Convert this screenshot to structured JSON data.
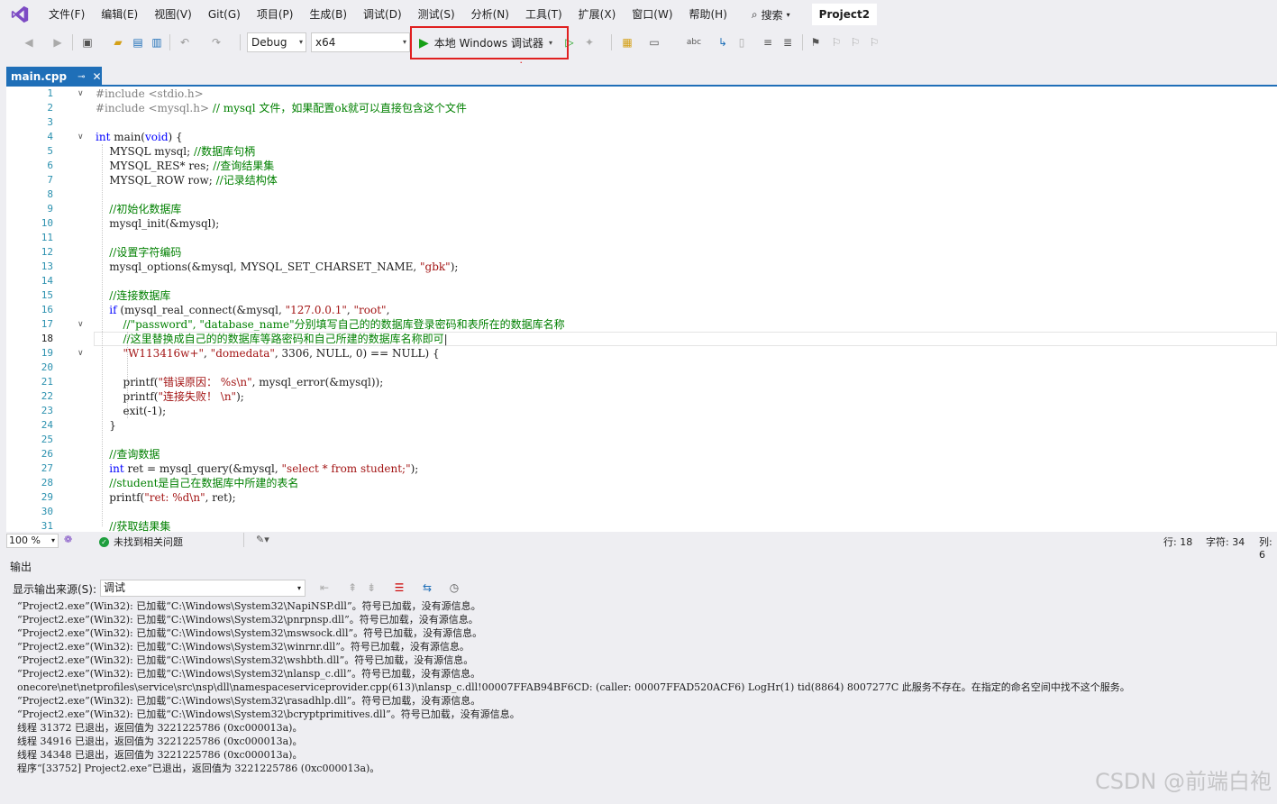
{
  "menubar": {
    "items": [
      "文件(F)",
      "编辑(E)",
      "视图(V)",
      "Git(G)",
      "项目(P)",
      "生成(B)",
      "调试(D)",
      "测试(S)",
      "分析(N)",
      "工具(T)",
      "扩展(X)",
      "窗口(W)",
      "帮助(H)"
    ],
    "search_label": "搜索",
    "project_name": "Project2"
  },
  "toolbar": {
    "config": "Debug",
    "platform": "x64",
    "run_label": "本地 Windows 调试器"
  },
  "tab": {
    "filename": "main.cpp"
  },
  "code_lines": [
    {
      "n": "1",
      "fold": "v",
      "html": "<span class=\"pp\">#include &lt;stdio.h&gt;</span>"
    },
    {
      "n": "2",
      "fold": "",
      "html": "<span class=\"pp\">#include &lt;mysql.h&gt;</span> <span class=\"cm\">// mysql 文件，如果配置ok就可以直接包含这个文件</span>"
    },
    {
      "n": "3",
      "fold": "",
      "html": ""
    },
    {
      "n": "4",
      "fold": "v",
      "html": "<span class=\"kw\">int</span> main(<span class=\"kw\">void</span>) {"
    },
    {
      "n": "5",
      "fold": "",
      "html": "    MYSQL mysql; <span class=\"cm\">//数据库句柄</span>"
    },
    {
      "n": "6",
      "fold": "",
      "html": "    MYSQL_RES* res; <span class=\"cm\">//查询结果集</span>"
    },
    {
      "n": "7",
      "fold": "",
      "html": "    MYSQL_ROW row; <span class=\"cm\">//记录结构体</span>"
    },
    {
      "n": "8",
      "fold": "",
      "html": ""
    },
    {
      "n": "9",
      "fold": "",
      "html": "    <span class=\"cm\">//初始化数据库</span>"
    },
    {
      "n": "10",
      "fold": "",
      "html": "    mysql_init(&amp;mysql);"
    },
    {
      "n": "11",
      "fold": "",
      "html": ""
    },
    {
      "n": "12",
      "fold": "",
      "html": "    <span class=\"cm\">//设置字符编码</span>"
    },
    {
      "n": "13",
      "fold": "",
      "html": "    mysql_options(&amp;mysql, MYSQL_SET_CHARSET_NAME, <span class=\"st\">\"gbk\"</span>);"
    },
    {
      "n": "14",
      "fold": "",
      "html": ""
    },
    {
      "n": "15",
      "fold": "",
      "html": "    <span class=\"cm\">//连接数据库</span>"
    },
    {
      "n": "16",
      "fold": "",
      "html": "    <span class=\"kw\">if</span> (mysql_real_connect(&amp;mysql, <span class=\"st\">\"127.0.0.1\"</span>, <span class=\"st\">\"root\"</span>,"
    },
    {
      "n": "17",
      "fold": "v",
      "html": "        <span class=\"cm\">//\"password\", \"database_name\"分别填写自己的的数据库登录密码和表所在的数据库名称</span>"
    },
    {
      "n": "18",
      "fold": "",
      "html": "        <span class=\"cm\">//这里替换成自己的的数据库等路密码和自己所建的数据库名称即可</span>|"
    },
    {
      "n": "19",
      "fold": "v",
      "html": "        <span class=\"st\">\"W113416w+\"</span>, <span class=\"st\">\"domedata\"</span>, 3306, NULL, 0) == NULL) {"
    },
    {
      "n": "20",
      "fold": "",
      "html": ""
    },
    {
      "n": "21",
      "fold": "",
      "html": "        printf(<span class=\"st\">\"错误原因： %s\\n\"</span>, mysql_error(&amp;mysql));"
    },
    {
      "n": "22",
      "fold": "",
      "html": "        printf(<span class=\"st\">\"连接失败！ \\n\"</span>);"
    },
    {
      "n": "23",
      "fold": "",
      "html": "        exit(-1);"
    },
    {
      "n": "24",
      "fold": "",
      "html": "    }"
    },
    {
      "n": "25",
      "fold": "",
      "html": ""
    },
    {
      "n": "26",
      "fold": "",
      "html": "    <span class=\"cm\">//查询数据</span>"
    },
    {
      "n": "27",
      "fold": "",
      "html": "    <span class=\"kw\">int</span> ret = mysql_query(&amp;mysql, <span class=\"st\">\"select * from student;\"</span>);"
    },
    {
      "n": "28",
      "fold": "",
      "html": "    <span class=\"cm\">//student是自己在数据库中所建的表名</span>"
    },
    {
      "n": "29",
      "fold": "",
      "html": "    printf(<span class=\"st\">\"ret: %d\\n\"</span>, ret);"
    },
    {
      "n": "30",
      "fold": "",
      "html": ""
    },
    {
      "n": "31",
      "fold": "",
      "html": "    <span class=\"cm\">//获取结果集</span>"
    }
  ],
  "editor_status": {
    "zoom": "100 %",
    "issues": "未找到相关问题",
    "line": "行: 18",
    "char": "字符: 34",
    "col": "列: 6"
  },
  "output": {
    "title": "输出",
    "source_label": "显示输出来源(S):",
    "source_value": "调试",
    "lines": [
      "“Project2.exe”(Win32): 已加载“C:\\Windows\\System32\\NapiNSP.dll”。符号已加载，没有源信息。",
      "“Project2.exe”(Win32): 已加载“C:\\Windows\\System32\\pnrpnsp.dll”。符号已加载，没有源信息。",
      "“Project2.exe”(Win32): 已加载“C:\\Windows\\System32\\mswsock.dll”。符号已加载，没有源信息。",
      "“Project2.exe”(Win32): 已加载“C:\\Windows\\System32\\winrnr.dll”。符号已加载，没有源信息。",
      "“Project2.exe”(Win32): 已加载“C:\\Windows\\System32\\wshbth.dll”。符号已加载，没有源信息。",
      "“Project2.exe”(Win32): 已加载“C:\\Windows\\System32\\nlansp_c.dll”。符号已加载，没有源信息。",
      "onecore\\net\\netprofiles\\service\\src\\nsp\\dll\\namespaceserviceprovider.cpp(613)\\nlansp_c.dll!00007FFAB94BF6CD: (caller: 00007FFAD520ACF6) LogHr(1) tid(8864) 8007277C 此服务不存在。在指定的命名空间中找不这个服务。",
      "“Project2.exe”(Win32): 已加载“C:\\Windows\\System32\\rasadhlp.dll”。符号已加载，没有源信息。",
      "“Project2.exe”(Win32): 已加载“C:\\Windows\\System32\\bcryptprimitives.dll”。符号已加载，没有源信息。",
      "线程 31372 已退出，返回值为 3221225786 (0xc000013a)。",
      "线程 34916 已退出，返回值为 3221225786 (0xc000013a)。",
      "线程 34348 已退出，返回值为 3221225786 (0xc000013a)。",
      "程序“[33752] Project2.exe”已退出，返回值为 3221225786 (0xc000013a)。"
    ]
  },
  "watermark": "CSDN @前端白袍"
}
